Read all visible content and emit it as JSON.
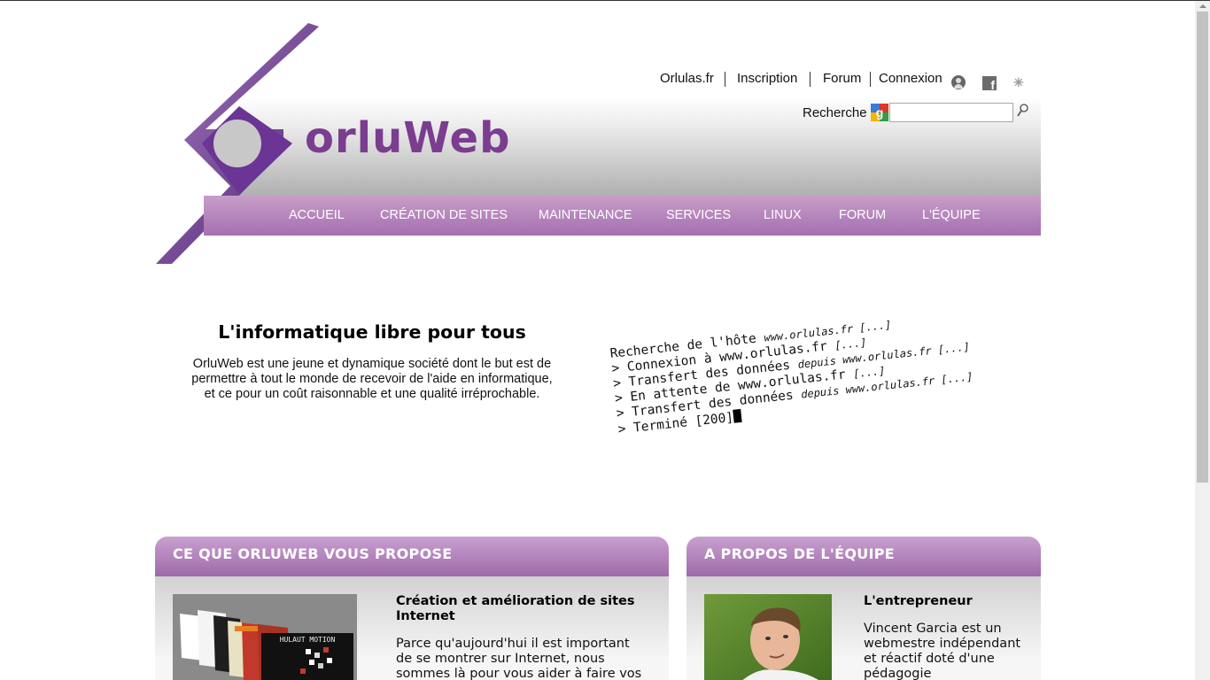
{
  "header": {
    "logo_text": "orluWeb",
    "top_links": [
      "Orlulas.fr",
      "Inscription",
      "Forum",
      "Connexion"
    ],
    "social_icons": [
      "user-icon",
      "facebook-icon",
      "twitter-icon"
    ],
    "search": {
      "label": "Recherche",
      "value": ""
    }
  },
  "nav": {
    "items": [
      "ACCUEIL",
      "CRÉATION DE SITES",
      "MAINTENANCE",
      "SERVICES",
      "LINUX",
      "FORUM",
      "L'ÉQUIPE"
    ]
  },
  "intro": {
    "title": "L'informatique libre pour tous",
    "lines": [
      "OrluWeb est une jeune et dynamique société dont le but est de",
      "permettre à tout le monde de recevoir de l'aide en informatique,",
      "et ce pour un coût raisonnable et une qualité irréprochable."
    ]
  },
  "terminal": {
    "lines": [
      {
        "text": "Recherche de l'hôte ",
        "em": "www.orlulas.fr [...]"
      },
      {
        "text": "> Connexion à www.orlulas.fr ",
        "em": "[...]"
      },
      {
        "text": "> Transfert des données ",
        "em": "depuis www.orlulas.fr [...]"
      },
      {
        "text": "> En attente de www.orlulas.fr ",
        "em": "[...]"
      },
      {
        "text": "> Transfert des données ",
        "em": "depuis www.orlulas.fr [...]"
      },
      {
        "text": "> Terminé [200]",
        "em": ""
      }
    ]
  },
  "panels": {
    "services": {
      "title": "CE QUE ORLUWEB VOUS PROPOSE",
      "subtitle_lines": [
        "Création et amélioration de sites",
        "Internet"
      ],
      "text_lines": [
        "Parce qu'aujourd'hui il est important",
        "de se montrer sur Internet, nous",
        "sommes là pour vous aider à faire vos"
      ],
      "image_caption": "HULAUT MOTION"
    },
    "team": {
      "title": "A PROPOS DE L'ÉQUIPE",
      "subtitle": "L'entrepreneur",
      "text_lines": [
        "Vincent Garcia est un",
        "webmestre indépendant",
        "et réactif doté d'une",
        "pédagogie"
      ]
    }
  },
  "colors": {
    "purple_dark": "#5e2a86",
    "purple_logo": "#7b3d8f",
    "nav_top": "#c89ec8",
    "nav_bottom": "#a46fb0"
  }
}
